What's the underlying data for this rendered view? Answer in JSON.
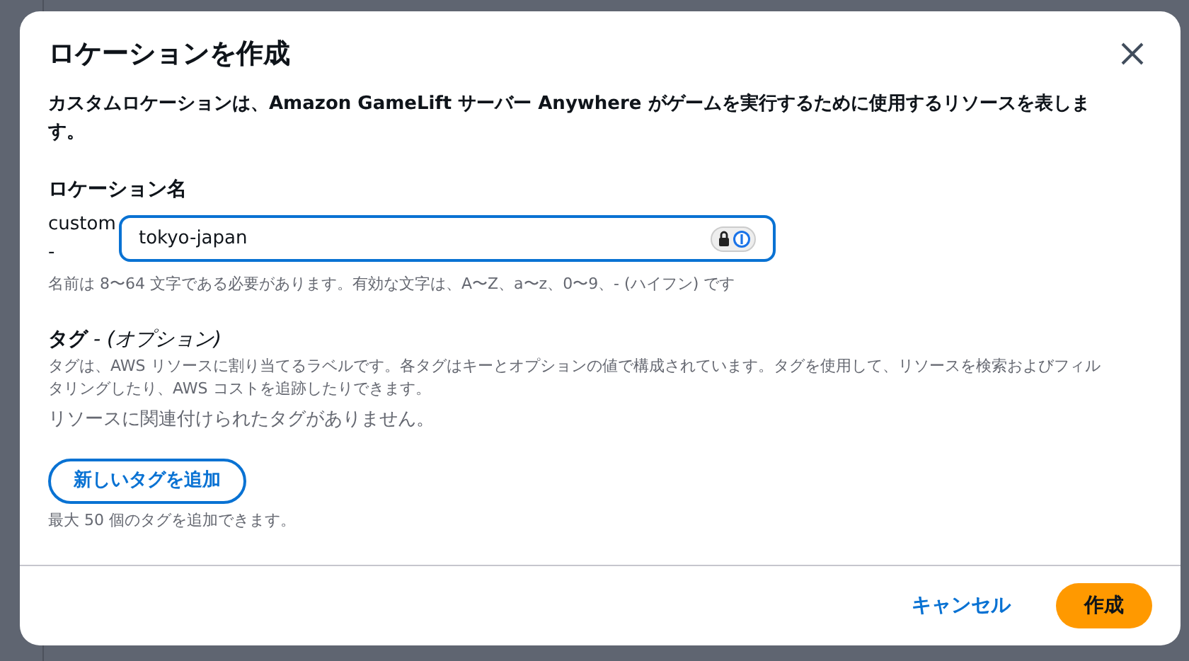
{
  "dialog": {
    "title": "ロケーションを作成",
    "description": "カスタムロケーションは、Amazon GameLift サーバー Anywhere がゲームを実行するために使用するリソースを表します。"
  },
  "location_name": {
    "label": "ロケーション名",
    "prefix": "custom",
    "prefix_separator": "-",
    "value": "tokyo-japan",
    "hint": "名前は 8〜64 文字である必要があります。有効な文字は、A〜Z、a〜z、0〜9、- (ハイフン) です"
  },
  "tags": {
    "label": "タグ",
    "optional": "- (オプション)",
    "description": "タグは、AWS リソースに割り当てるラベルです。各タグはキーとオプションの値で構成されています。タグを使用して、リソースを検索およびフィルタリングしたり、AWS コストを追跡したりできます。",
    "empty": "リソースに関連付けられたタグがありません。",
    "add_button": "新しいタグを追加",
    "limit": "最大 50 個のタグを追加できます。"
  },
  "footer": {
    "buttons": [
      {
        "label": "キャンセル",
        "kind": "link"
      },
      {
        "label": "作成",
        "kind": "primary"
      }
    ]
  }
}
